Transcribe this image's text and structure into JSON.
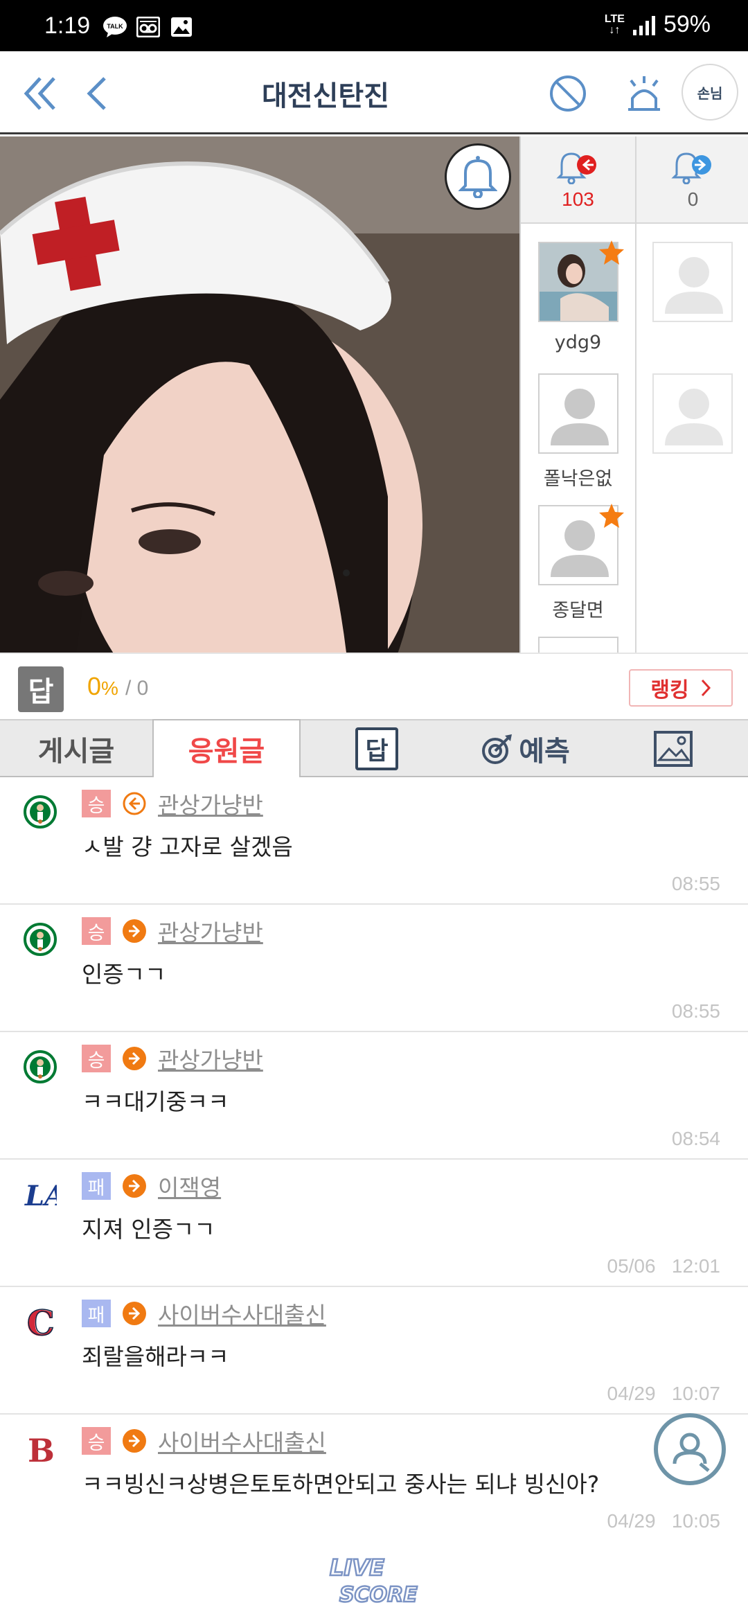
{
  "status_bar": {
    "time": "1:19",
    "network": "LTE",
    "battery": "59%"
  },
  "header": {
    "title": "대전신탄진",
    "guest_label": "손님"
  },
  "side_panel": {
    "incoming_count": "103",
    "outgoing_count": "0",
    "left_users": [
      {
        "name": "ydg9",
        "starred": true,
        "has_photo": true
      },
      {
        "name": "폴낙은없",
        "starred": false,
        "has_photo": false
      },
      {
        "name": "종달면",
        "starred": true,
        "has_photo": false
      }
    ]
  },
  "stats": {
    "dap_label": "답",
    "rate": "0",
    "rate_symbol": "%",
    "total": "/ 0",
    "ranking_label": "랭킹"
  },
  "tabs": [
    {
      "label": "게시글"
    },
    {
      "label": "응원글"
    },
    {
      "label": "답"
    },
    {
      "label": "예측"
    }
  ],
  "comments": [
    {
      "team": "celtics",
      "result": "승",
      "direction": "left",
      "author": "관상가냥반",
      "text": "ㅅ발 걍 고자로 살겠음",
      "date": "",
      "time": "08:55"
    },
    {
      "team": "celtics",
      "result": "승",
      "direction": "right",
      "author": "관상가냥반",
      "text": "인증ㄱㄱ",
      "date": "",
      "time": "08:55"
    },
    {
      "team": "celtics",
      "result": "승",
      "direction": "right",
      "author": "관상가냥반",
      "text": "ㅋㅋ대기중ㅋㅋ",
      "date": "",
      "time": "08:54"
    },
    {
      "team": "dodgers",
      "result": "패",
      "direction": "right",
      "author": "이잭영",
      "text": "지져 인증ㄱㄱ",
      "date": "05/06",
      "time": "12:01"
    },
    {
      "team": "guardians",
      "result": "패",
      "direction": "right",
      "author": "사이버수사대출신",
      "text": "죄랄을해라ㅋㅋ",
      "date": "04/29",
      "time": "10:07"
    },
    {
      "team": "redsox",
      "result": "승",
      "direction": "right",
      "author": "사이버수사대출신",
      "text": "ㅋㅋ빙신ㅋ상병은토토하면안되고 중사는 되냐 빙신아?",
      "date": "04/29",
      "time": "10:05"
    }
  ],
  "footer": {
    "logo_text_1": "LIVE",
    "logo_text_2": "SCORE"
  },
  "colors": {
    "accent_red": "#e02020",
    "win_badge": "#f29b9b",
    "lose_badge": "#a9b8f0",
    "title": "#2e3f58",
    "arrow_orange": "#f07a12"
  }
}
